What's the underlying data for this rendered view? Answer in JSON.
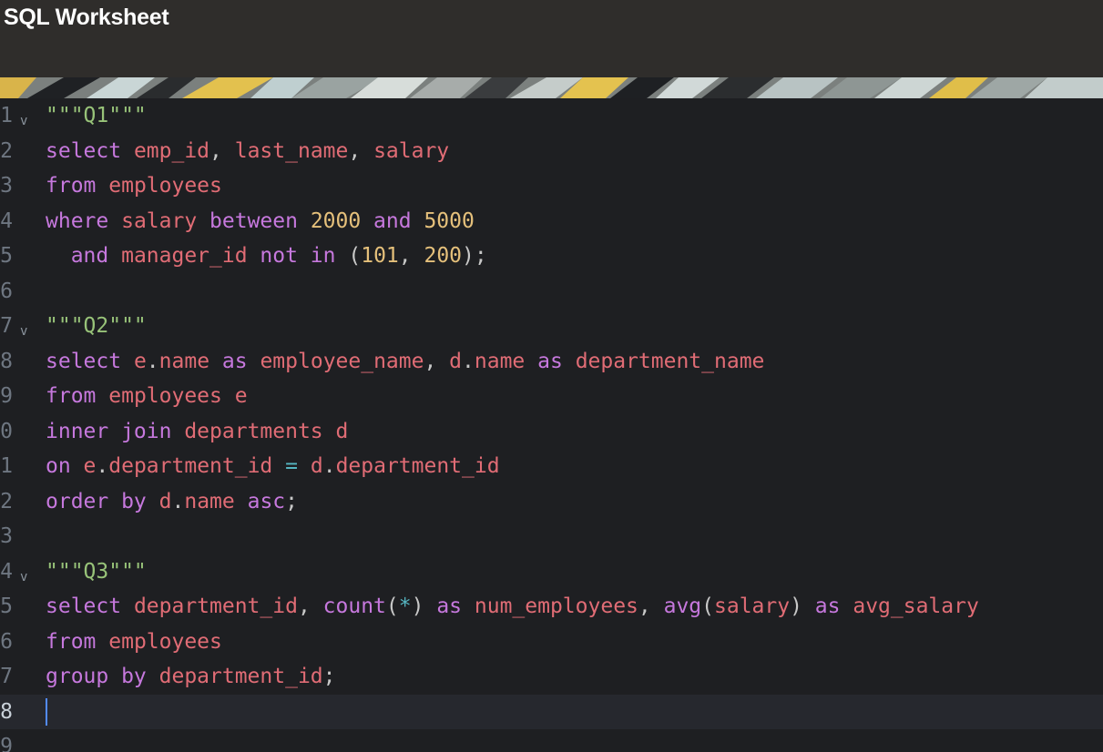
{
  "window": {
    "title": "SQL Worksheet"
  },
  "editor": {
    "lines": [
      {
        "num": "1",
        "fold": "v",
        "tokens": [
          [
            "s",
            "\"\"\"Q1\"\"\""
          ]
        ]
      },
      {
        "num": "2",
        "tokens": [
          [
            "k",
            "select "
          ],
          [
            "i",
            "emp_id"
          ],
          [
            "p",
            ", "
          ],
          [
            "i",
            "last_name"
          ],
          [
            "p",
            ", "
          ],
          [
            "i",
            "salary"
          ]
        ]
      },
      {
        "num": "3",
        "tokens": [
          [
            "k",
            "from "
          ],
          [
            "i",
            "employees"
          ]
        ]
      },
      {
        "num": "4",
        "tokens": [
          [
            "k",
            "where "
          ],
          [
            "i",
            "salary "
          ],
          [
            "k",
            "between "
          ],
          [
            "n",
            "2000"
          ],
          [
            "k",
            " and "
          ],
          [
            "n",
            "5000"
          ]
        ]
      },
      {
        "num": "5",
        "tokens": [
          [
            "p",
            "  "
          ],
          [
            "k",
            "and "
          ],
          [
            "i",
            "manager_id "
          ],
          [
            "k",
            "not in "
          ],
          [
            "p",
            "("
          ],
          [
            "n",
            "101"
          ],
          [
            "p",
            ", "
          ],
          [
            "n",
            "200"
          ],
          [
            "p",
            ");"
          ]
        ]
      },
      {
        "num": "6",
        "tokens": []
      },
      {
        "num": "7",
        "fold": "v",
        "tokens": [
          [
            "s",
            "\"\"\"Q2\"\"\""
          ]
        ]
      },
      {
        "num": "8",
        "tokens": [
          [
            "k",
            "select "
          ],
          [
            "i",
            "e"
          ],
          [
            "p",
            "."
          ],
          [
            "i",
            "name "
          ],
          [
            "k",
            "as "
          ],
          [
            "i",
            "employee_name"
          ],
          [
            "p",
            ", "
          ],
          [
            "i",
            "d"
          ],
          [
            "p",
            "."
          ],
          [
            "i",
            "name "
          ],
          [
            "k",
            "as "
          ],
          [
            "i",
            "department_name"
          ]
        ]
      },
      {
        "num": "9",
        "tokens": [
          [
            "k",
            "from "
          ],
          [
            "i",
            "employees e"
          ]
        ]
      },
      {
        "num": "0",
        "tokens": [
          [
            "k",
            "inner join "
          ],
          [
            "i",
            "departments d"
          ]
        ]
      },
      {
        "num": "1",
        "tokens": [
          [
            "k",
            "on "
          ],
          [
            "i",
            "e"
          ],
          [
            "p",
            "."
          ],
          [
            "i",
            "department_id "
          ],
          [
            "o",
            "="
          ],
          [
            "i",
            " d"
          ],
          [
            "p",
            "."
          ],
          [
            "i",
            "department_id"
          ]
        ]
      },
      {
        "num": "2",
        "tokens": [
          [
            "k",
            "order by "
          ],
          [
            "i",
            "d"
          ],
          [
            "p",
            "."
          ],
          [
            "i",
            "name "
          ],
          [
            "k",
            "asc"
          ],
          [
            "p",
            ";"
          ]
        ]
      },
      {
        "num": "3",
        "tokens": []
      },
      {
        "num": "4",
        "fold": "v",
        "tokens": [
          [
            "s",
            "\"\"\"Q3\"\"\""
          ]
        ]
      },
      {
        "num": "5",
        "tokens": [
          [
            "k",
            "select "
          ],
          [
            "i",
            "department_id"
          ],
          [
            "p",
            ", "
          ],
          [
            "k",
            "count"
          ],
          [
            "p",
            "("
          ],
          [
            "o",
            "*"
          ],
          [
            "p",
            ") "
          ],
          [
            "k",
            "as "
          ],
          [
            "i",
            "num_employees"
          ],
          [
            "p",
            ", "
          ],
          [
            "k",
            "avg"
          ],
          [
            "p",
            "("
          ],
          [
            "i",
            "salary"
          ],
          [
            "p",
            ") "
          ],
          [
            "k",
            "as "
          ],
          [
            "i",
            "avg_salary"
          ]
        ]
      },
      {
        "num": "6",
        "tokens": [
          [
            "k",
            "from "
          ],
          [
            "i",
            "employees"
          ]
        ]
      },
      {
        "num": "7",
        "tokens": [
          [
            "k",
            "group by "
          ],
          [
            "i",
            "department_id"
          ],
          [
            "p",
            ";"
          ]
        ]
      },
      {
        "num": "8",
        "current": true,
        "tokens": []
      },
      {
        "num": "9",
        "tokens": []
      }
    ]
  }
}
